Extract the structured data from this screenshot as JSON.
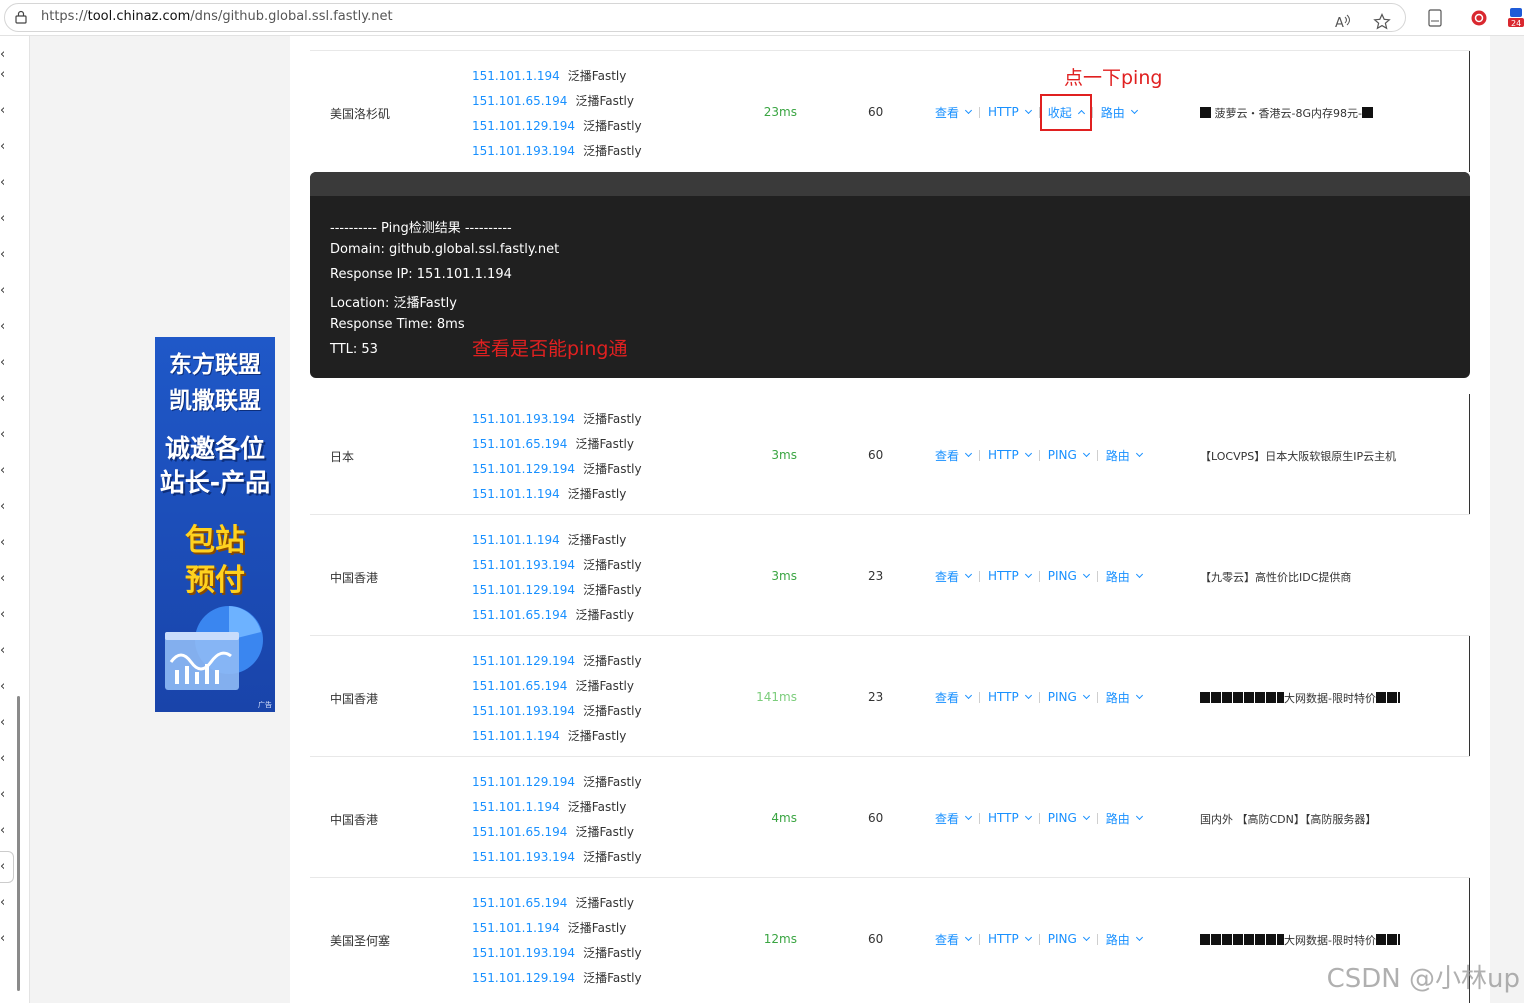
{
  "browser": {
    "url_prefix": "https://",
    "url_host": "tool.chinaz.com",
    "url_path": "/dns/github.global.ssl.fastly.net",
    "badge": "24"
  },
  "ad": {
    "line1": "东方联盟",
    "line2": "凯撒联盟",
    "line3": "诚邀各位",
    "line4": "站长-产品",
    "line5": "包站",
    "line6": "预付",
    "tag": "广告"
  },
  "ops_labels": {
    "view": "查看",
    "http": "HTTP",
    "ping": "PING",
    "route": "路由",
    "collapse": "收起"
  },
  "annotations": {
    "click_ping": "点一下ping",
    "check_ping": "查看是否能ping通"
  },
  "ping_result": {
    "title": "---------- Ping检测结果 ----------",
    "domain": "Domain: github.global.ssl.fastly.net",
    "ip": "Response IP: 151.101.1.194",
    "location": "Location: 泛播Fastly",
    "time": "Response Time: 8ms",
    "ttl": "TTL: 53"
  },
  "rows": [
    {
      "location": "美国洛杉矶",
      "ips": [
        {
          "ip": "151.101.1.194",
          "isp": "泛播Fastly"
        },
        {
          "ip": "151.101.65.194",
          "isp": "泛播Fastly"
        },
        {
          "ip": "151.101.129.194",
          "isp": "泛播Fastly"
        },
        {
          "ip": "151.101.193.194",
          "isp": "泛播Fastly"
        }
      ],
      "ms": "23ms",
      "ttl": "60",
      "sponsor": "菠萝云・香港云-8G内存98元-"
    },
    {
      "location": "日本",
      "ips": [
        {
          "ip": "151.101.193.194",
          "isp": "泛播Fastly"
        },
        {
          "ip": "151.101.65.194",
          "isp": "泛播Fastly"
        },
        {
          "ip": "151.101.129.194",
          "isp": "泛播Fastly"
        },
        {
          "ip": "151.101.1.194",
          "isp": "泛播Fastly"
        }
      ],
      "ms": "3ms",
      "ttl": "60",
      "sponsor": "【LOCVPS】日本大阪软银原生IP云主机"
    },
    {
      "location": "中国香港",
      "ips": [
        {
          "ip": "151.101.1.194",
          "isp": "泛播Fastly"
        },
        {
          "ip": "151.101.193.194",
          "isp": "泛播Fastly"
        },
        {
          "ip": "151.101.129.194",
          "isp": "泛播Fastly"
        },
        {
          "ip": "151.101.65.194",
          "isp": "泛播Fastly"
        }
      ],
      "ms": "3ms",
      "ttl": "23",
      "sponsor": "【九零云】高性价比IDC提供商"
    },
    {
      "location": "中国香港",
      "ips": [
        {
          "ip": "151.101.129.194",
          "isp": "泛播Fastly"
        },
        {
          "ip": "151.101.65.194",
          "isp": "泛播Fastly"
        },
        {
          "ip": "151.101.193.194",
          "isp": "泛播Fastly"
        },
        {
          "ip": "151.101.1.194",
          "isp": "泛播Fastly"
        }
      ],
      "ms": "141ms",
      "ttl": "23",
      "sponsor": "大网数据-限时特价"
    },
    {
      "location": "中国香港",
      "ips": [
        {
          "ip": "151.101.129.194",
          "isp": "泛播Fastly"
        },
        {
          "ip": "151.101.1.194",
          "isp": "泛播Fastly"
        },
        {
          "ip": "151.101.65.194",
          "isp": "泛播Fastly"
        },
        {
          "ip": "151.101.193.194",
          "isp": "泛播Fastly"
        }
      ],
      "ms": "4ms",
      "ttl": "60",
      "sponsor": "国内外 【高防CDN】【高防服务器】"
    },
    {
      "location": "美国圣何塞",
      "ips": [
        {
          "ip": "151.101.65.194",
          "isp": "泛播Fastly"
        },
        {
          "ip": "151.101.1.194",
          "isp": "泛播Fastly"
        },
        {
          "ip": "151.101.193.194",
          "isp": "泛播Fastly"
        },
        {
          "ip": "151.101.129.194",
          "isp": "泛播Fastly"
        }
      ],
      "ms": "12ms",
      "ttl": "60",
      "sponsor": "大网数据-限时特价"
    }
  ],
  "watermark": "CSDN @小林up"
}
